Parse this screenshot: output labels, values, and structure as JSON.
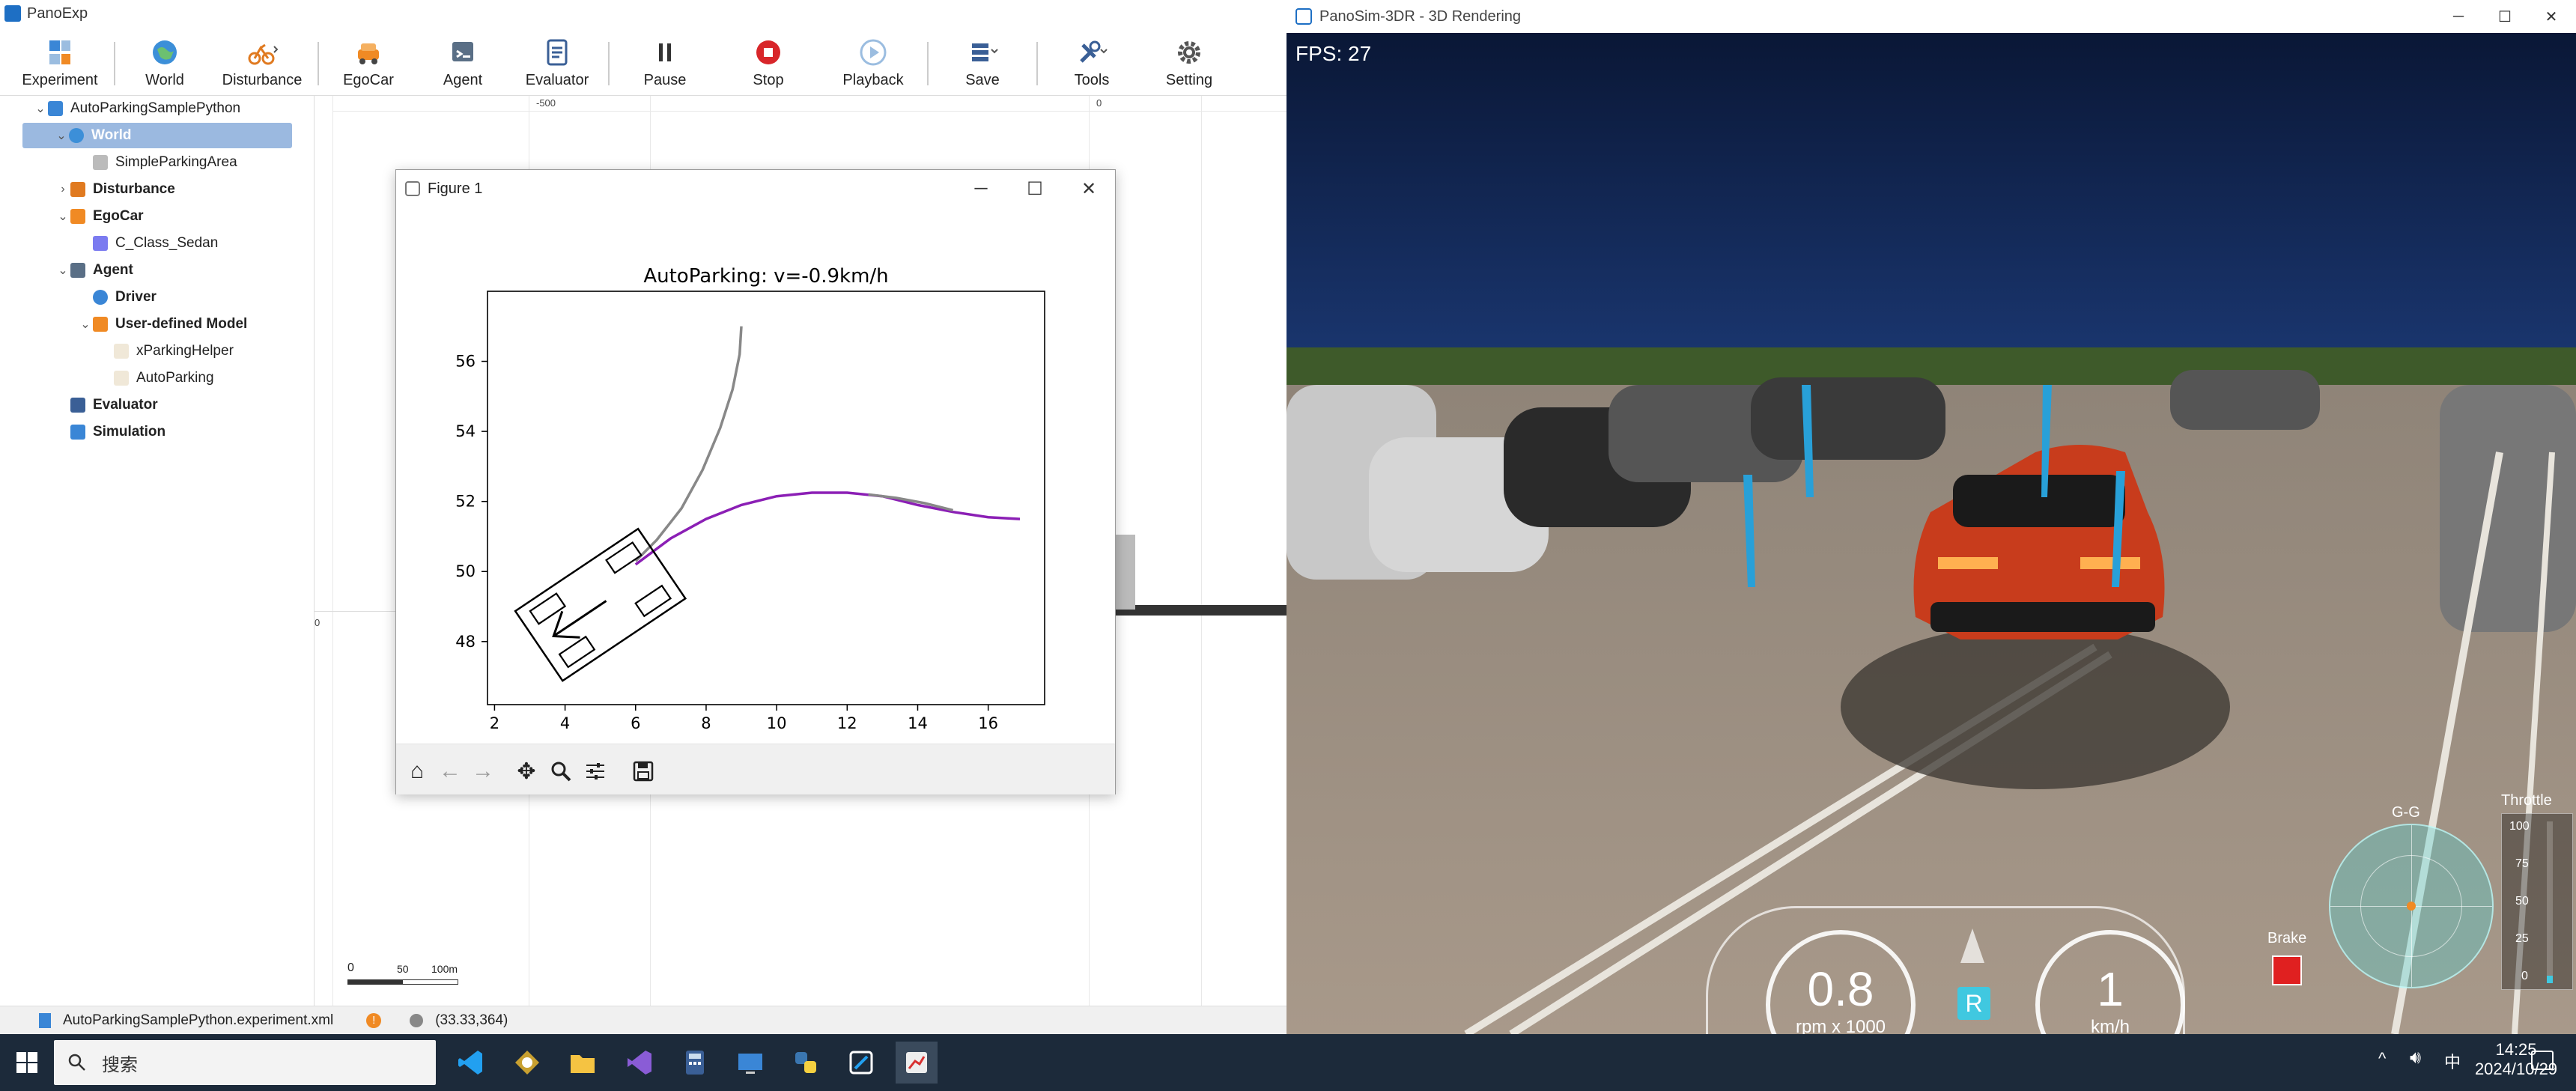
{
  "panoexp": {
    "title": "PanoExp",
    "toolbar": [
      {
        "label": "Experiment",
        "icon": "experiment-icon"
      },
      {
        "label": "World",
        "icon": "globe-icon"
      },
      {
        "label": "Disturbance",
        "icon": "disturbance-icon"
      },
      {
        "label": "EgoCar",
        "icon": "egocar-icon"
      },
      {
        "label": "Agent",
        "icon": "agent-icon"
      },
      {
        "label": "Evaluator",
        "icon": "evaluator-icon"
      },
      {
        "label": "Pause",
        "icon": "pause-icon"
      },
      {
        "label": "Stop",
        "icon": "stop-icon"
      },
      {
        "label": "Playback",
        "icon": "playback-icon"
      },
      {
        "label": "Save",
        "icon": "save-icon"
      },
      {
        "label": "Tools",
        "icon": "tools-icon"
      },
      {
        "label": "Setting",
        "icon": "gear-icon"
      }
    ],
    "tree": {
      "root": "AutoParkingSamplePython",
      "world": "World",
      "simple_parking_area": "SimpleParkingArea",
      "disturbance": "Disturbance",
      "egocar": "EgoCar",
      "c_class_sedan": "C_Class_Sedan",
      "agent": "Agent",
      "driver": "Driver",
      "user_defined_model": "User-defined Model",
      "xparking_helper": "xParkingHelper",
      "autoparking": "AutoParking",
      "evaluator": "Evaluator",
      "simulation": "Simulation"
    },
    "canvas": {
      "ruler_minus500": "-500",
      "ruler_zero_top": "0",
      "ruler_zero_left": "0",
      "scale_0": "0",
      "scale_50": "50",
      "scale_100": "100m"
    },
    "status": {
      "file": "AutoParkingSamplePython.experiment.xml",
      "coords": "(33.33,364)"
    }
  },
  "figure": {
    "title": "Figure 1"
  },
  "chart_data": {
    "type": "line",
    "title": "AutoParking: v=-0.9km/h",
    "xlabel": "",
    "ylabel": "",
    "xlim": [
      1.8,
      17.6
    ],
    "ylim": [
      46.2,
      58
    ],
    "xticks": [
      "2",
      "4",
      "6",
      "8",
      "10",
      "12",
      "14",
      "16"
    ],
    "yticks": [
      "48",
      "50",
      "52",
      "54",
      "56"
    ],
    "grid": false,
    "series": [
      {
        "color": "#888888",
        "x": [
          6.0,
          6.6,
          7.3,
          7.9,
          8.4,
          8.75,
          8.95,
          9.0
        ],
        "y": [
          50.3,
          50.9,
          51.8,
          52.9,
          54.1,
          55.2,
          56.2,
          57.0
        ]
      },
      {
        "color": "#8b1fb5",
        "x": [
          6.0,
          7.0,
          8.0,
          9.0,
          10.0,
          11.0,
          12.0,
          13.0,
          14.0,
          15.0,
          16.0,
          16.9
        ],
        "y": [
          50.2,
          50.95,
          51.5,
          51.9,
          52.15,
          52.25,
          52.25,
          52.15,
          51.9,
          51.7,
          51.55,
          51.5
        ]
      },
      {
        "color": "#888888",
        "x": [
          12.6,
          13.4,
          14.2,
          15.0
        ],
        "y": [
          52.2,
          52.1,
          51.95,
          51.75
        ]
      }
    ],
    "vehicle": {
      "center": [
        5.0,
        49.05
      ],
      "length": 4.2,
      "width": 2.4,
      "heading_deg": 214
    }
  },
  "render": {
    "title": "PanoSim-3DR - 3D Rendering",
    "fps": "FPS: 27",
    "gg_label": "G-G",
    "throttle_label": "Throttle",
    "throttle_ticks": [
      "100",
      "75",
      "50",
      "25",
      "0"
    ],
    "brake_label": "Brake",
    "rpm_value": "0.8",
    "rpm_unit": "rpm x 1000",
    "gear": "R",
    "speed_value": "1",
    "speed_unit": "km/h",
    "colors": {
      "brake": "#e02020",
      "gear": "#40c8e0",
      "gg": "#4fd0d0"
    }
  },
  "taskbar": {
    "search_placeholder": "搜索",
    "time": "14:25",
    "date": "2024/10/29"
  }
}
